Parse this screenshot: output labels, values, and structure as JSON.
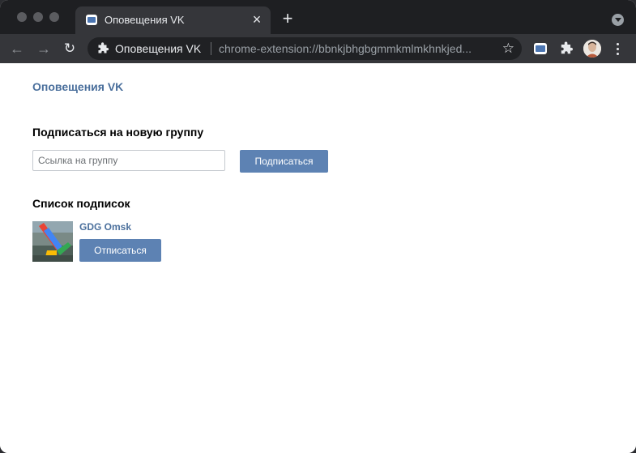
{
  "browser": {
    "tab_title": "Оповещения VK",
    "omnibox": {
      "site_name": "Оповещения VK",
      "url": "chrome-extension://bbnkjbhgbgmmkmlmkhnkjed..."
    }
  },
  "page": {
    "app_title": "Оповещения VK",
    "subscribe_section": {
      "heading": "Подписаться на новую группу",
      "input_placeholder": "Ссылка на группу",
      "input_value": "",
      "button_label": "Подписаться"
    },
    "subscriptions_section": {
      "heading": "Список подписок",
      "groups": [
        {
          "name": "GDG Omsk",
          "button_label": "Отписаться"
        }
      ]
    }
  },
  "colors": {
    "accent": "#5d82b3",
    "link": "#4a6f9c",
    "titlebar": "#1e1f22",
    "toolbar": "#35363a"
  }
}
